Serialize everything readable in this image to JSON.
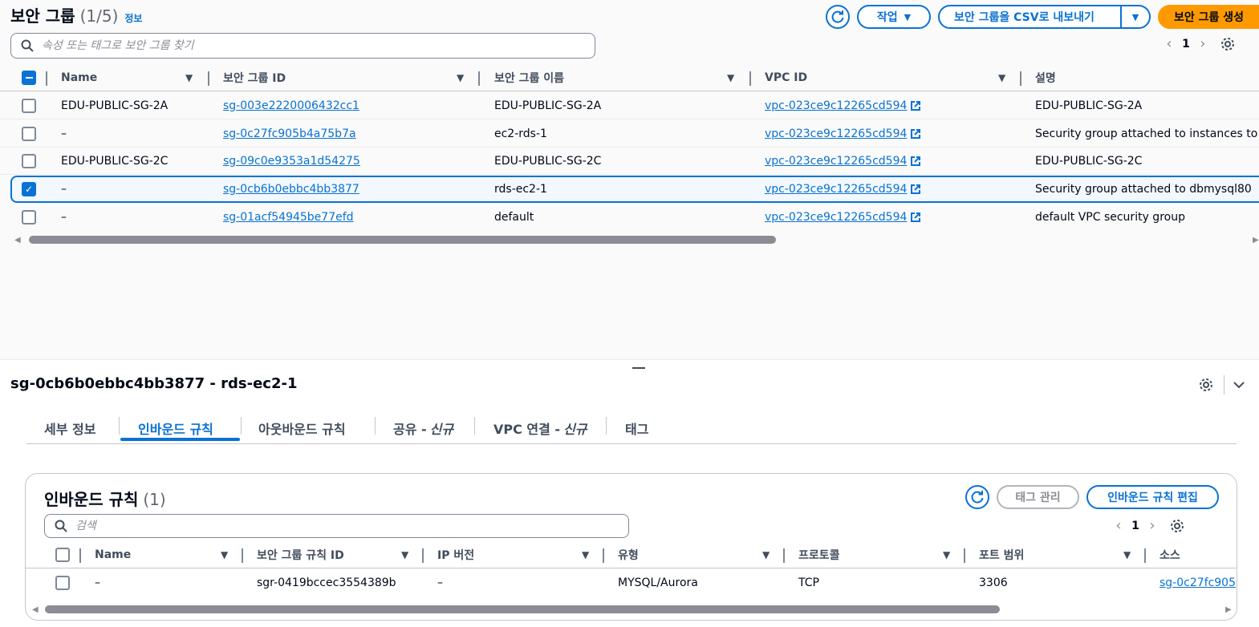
{
  "header": {
    "title": "보안 그룹",
    "count": "(1/5)",
    "info": "정보"
  },
  "actions": {
    "refresh": "refresh",
    "actions_label": "작업",
    "export_label": "보안 그룹을 CSV로 내보내기",
    "create_label": "보안 그룹 생성"
  },
  "search": {
    "placeholder": "속성 또는 태그로 보안 그룹 찾기"
  },
  "pagination": {
    "page": "1"
  },
  "table": {
    "columns": [
      "Name",
      "보안 그룹 ID",
      "보안 그룹 이름",
      "VPC ID",
      "설명"
    ],
    "rows": [
      {
        "name": "EDU-PUBLIC-SG-2A",
        "id": "sg-003e2220006432cc1",
        "group_name": "EDU-PUBLIC-SG-2A",
        "vpc": "vpc-023ce9c12265cd594",
        "desc": "EDU-PUBLIC-SG-2A",
        "checked": false
      },
      {
        "name": "–",
        "id": "sg-0c27fc905b4a75b7a",
        "group_name": "ec2-rds-1",
        "vpc": "vpc-023ce9c12265cd594",
        "desc": "Security group attached to instances to",
        "checked": false
      },
      {
        "name": "EDU-PUBLIC-SG-2C",
        "id": "sg-09c0e9353a1d54275",
        "group_name": "EDU-PUBLIC-SG-2C",
        "vpc": "vpc-023ce9c12265cd594",
        "desc": "EDU-PUBLIC-SG-2C",
        "checked": false
      },
      {
        "name": "–",
        "id": "sg-0cb6b0ebbc4bb3877",
        "group_name": "rds-ec2-1",
        "vpc": "vpc-023ce9c12265cd594",
        "desc": "Security group attached to dbmysql80",
        "checked": true
      },
      {
        "name": "–",
        "id": "sg-01acf54945be77efd",
        "group_name": "default",
        "vpc": "vpc-023ce9c12265cd594",
        "desc": "default VPC security group",
        "checked": false
      }
    ]
  },
  "detail": {
    "title": "sg-0cb6b0ebbc4bb3877 - rds-ec2-1",
    "tabs": [
      "세부 정보",
      "인바운드 규칙",
      "아웃바운드 규칙",
      "공유 -",
      "VPC 연결 -",
      "태그"
    ],
    "new_label": "신규",
    "inbound": {
      "title": "인바운드 규칙",
      "count": "(1)",
      "manage_tags": "태그 관리",
      "edit_rules": "인바운드 규칙 편집",
      "search_placeholder": "검색",
      "page": "1",
      "columns": [
        "Name",
        "보안 그룹 규칙 ID",
        "IP 버전",
        "유형",
        "프로토콜",
        "포트 범위",
        "소스"
      ],
      "rows": [
        {
          "name": "–",
          "rule_id": "sgr-0419bccec3554389b",
          "ip_version": "–",
          "type": "MYSQL/Aurora",
          "protocol": "TCP",
          "port": "3306",
          "source": "sg-0c27fc905"
        }
      ]
    }
  },
  "colors": {
    "accent": "#0972d3",
    "primary_button": "#ff9900"
  }
}
